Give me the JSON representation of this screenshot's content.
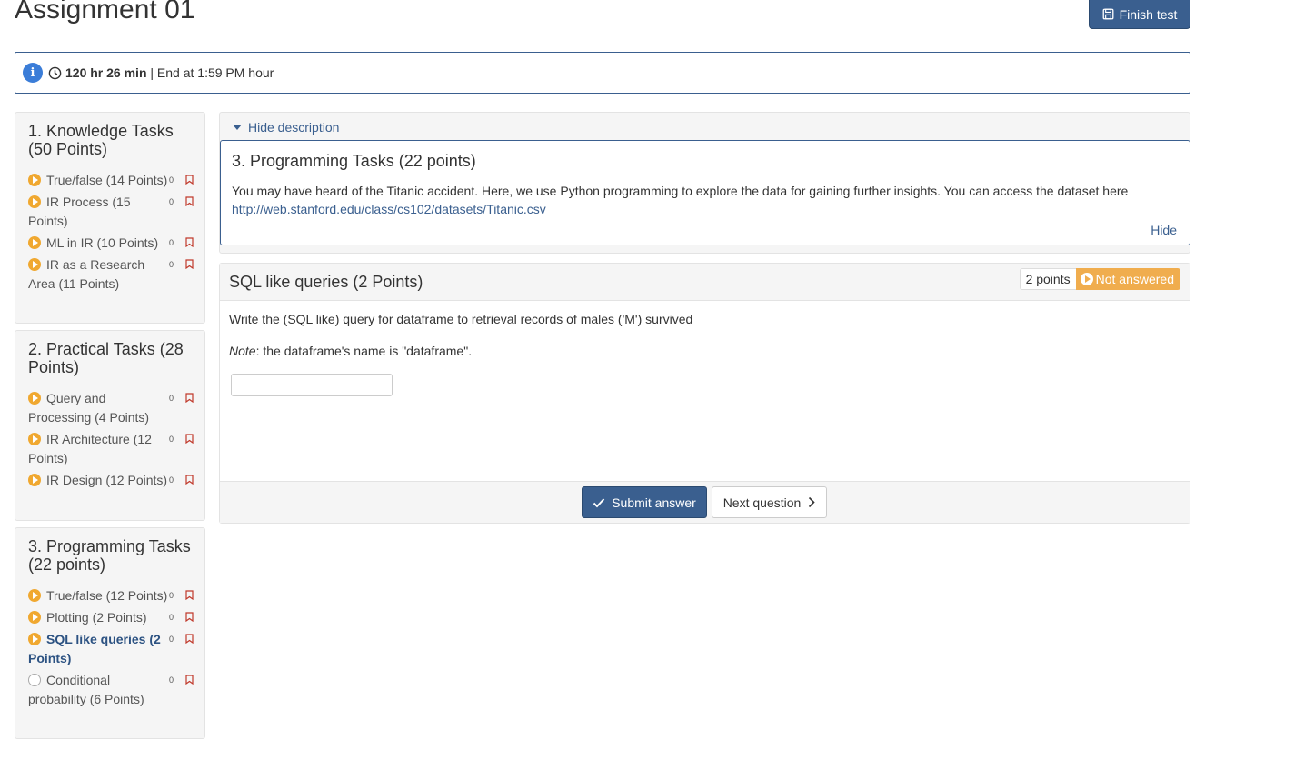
{
  "title": "Assignment 01",
  "header": {
    "finish_label": "Finish test"
  },
  "timer": {
    "remaining": "120 hr 26 min",
    "end_text": "| End at 1:59 PM hour"
  },
  "sidebar": {
    "sections": [
      {
        "title": "1. Knowledge Tasks (50 Points)",
        "items": [
          {
            "label": "True/false (14 Points)",
            "count": "0",
            "state": "started"
          },
          {
            "label": "IR Process (15 Points)",
            "count": "0",
            "state": "started"
          },
          {
            "label": "ML in IR (10 Points)",
            "count": "0",
            "state": "started"
          },
          {
            "label": "IR as a Research Area (11 Points)",
            "count": "0",
            "state": "started"
          }
        ]
      },
      {
        "title": "2. Practical Tasks (28 Points)",
        "items": [
          {
            "label": "Query and Processing (4 Points)",
            "count": "0",
            "state": "started"
          },
          {
            "label": "IR Architecture (12 Points)",
            "count": "0",
            "state": "started"
          },
          {
            "label": "IR Design (12 Points)",
            "count": "0",
            "state": "started"
          }
        ]
      },
      {
        "title": "3. Programming Tasks (22 points)",
        "items": [
          {
            "label": "True/false (12 Points)",
            "count": "0",
            "state": "started"
          },
          {
            "label": "Plotting (2 Points)",
            "count": "0",
            "state": "started"
          },
          {
            "label": "SQL like queries (2 Points)",
            "count": "0",
            "state": "active"
          },
          {
            "label": "Conditional probability (6 Points)",
            "count": "0",
            "state": "not-started"
          }
        ]
      }
    ]
  },
  "description": {
    "toggle_label": "Hide description",
    "title": "3. Programming Tasks (22 points)",
    "text": "You may have heard of the Titanic accident. Here, we use Python programming to explore the data for gaining further insights. You can access the dataset here",
    "link": "http://web.stanford.edu/class/cs102/datasets/Titanic.csv",
    "hide_label": "Hide"
  },
  "question": {
    "title": "SQL like queries (2 Points)",
    "points": "2 points",
    "status": "Not answered",
    "prompt": "Write the (SQL like) query for dataframe to retrieval records of males ('M') survived",
    "note_label": "Note",
    "note_text": ": the dataframe's name is \"dataframe\".",
    "answer_value": "",
    "submit_label": "Submit answer",
    "next_label": "Next question"
  },
  "colors": {
    "primary": "#3a5f8f",
    "warning": "#f0ad4e",
    "info": "#3b7dd8"
  }
}
